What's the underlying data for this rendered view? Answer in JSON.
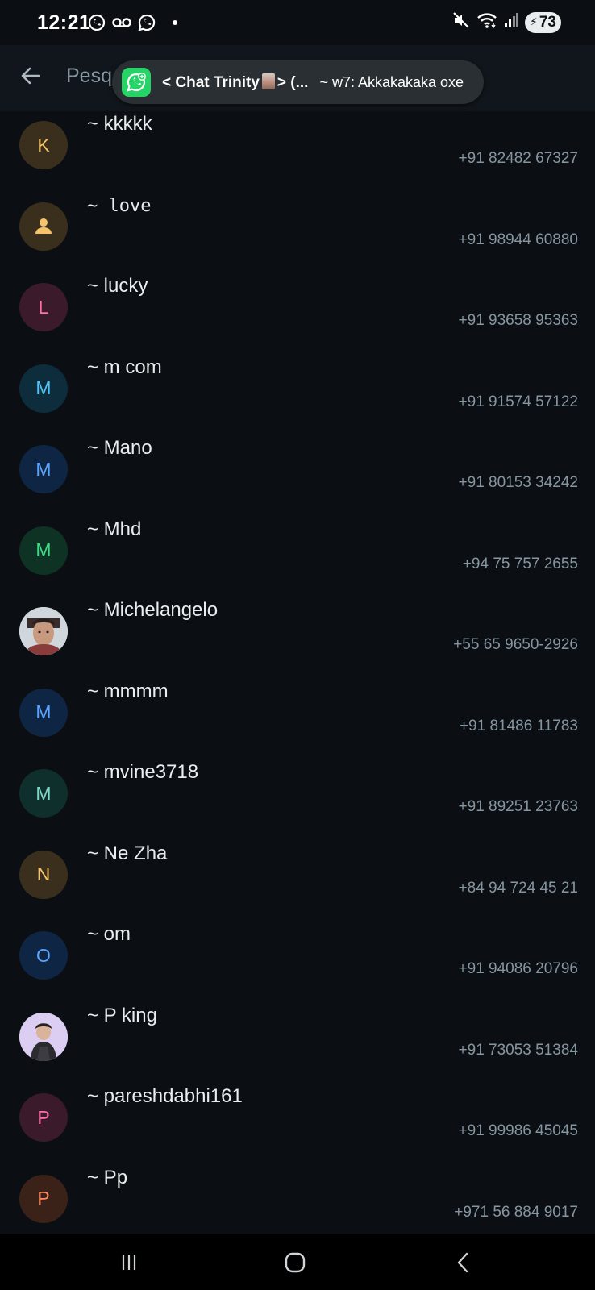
{
  "status_bar": {
    "time": "12:21",
    "left_icons": [
      "whatsapp-status-icon",
      "voicemail-icon",
      "whatsapp-icon",
      "notification-dot"
    ],
    "right_icons": [
      "mute-icon",
      "wifi-icon",
      "signal-icon"
    ],
    "battery": "73"
  },
  "header": {
    "back_icon": "arrow-left-icon",
    "search_text": "Pesq"
  },
  "notification": {
    "app_icon": "whatsapp-icon",
    "group_prefix": "< Chat Trinity",
    "group_suffix": "> (...",
    "message": "~ w7: Akkakakaka oxe"
  },
  "contacts": [
    {
      "name": "~ kkkkk",
      "phone": "+91 82482 67327",
      "initial": "K",
      "fg": "#f5c36b",
      "bg": "#3a2f1c",
      "mono": false
    },
    {
      "name": "~ love",
      "phone": "+91 98944 60880",
      "initial": "",
      "icon": "person-icon",
      "fg": "#f5c36b",
      "bg": "#3a2f1c",
      "mono": true
    },
    {
      "name": "~ lucky",
      "phone": "+91 93658 95363",
      "initial": "L",
      "fg": "#ff6fa8",
      "bg": "#3b1a2c",
      "mono": false
    },
    {
      "name": "~ m com",
      "phone": "+91 91574 57122",
      "initial": "M",
      "fg": "#4fc3f7",
      "bg": "#0d2d3c",
      "mono": false
    },
    {
      "name": "~ Mano",
      "phone": "+91 80153 34242",
      "initial": "M",
      "fg": "#5aa3ff",
      "bg": "#0f2544",
      "mono": false
    },
    {
      "name": "~ Mhd",
      "phone": "+94 75 757 2655",
      "initial": "M",
      "fg": "#3ddc84",
      "bg": "#0e3325",
      "mono": false
    },
    {
      "name": "~ Michelangelo",
      "phone": "+55 65 9650-2926",
      "initial": "",
      "photo": "photo-avatar-man",
      "fg": "#ffffff",
      "bg": "#c8d0d8",
      "mono": false
    },
    {
      "name": "~ mmmm",
      "phone": "+91 81486 11783",
      "initial": "M",
      "fg": "#5aa3ff",
      "bg": "#0f2544",
      "mono": false
    },
    {
      "name": "~ mvine3718",
      "phone": "+91 89251 23763",
      "initial": "M",
      "fg": "#7fd8c6",
      "bg": "#0f2f2c",
      "mono": false
    },
    {
      "name": "~ Ne Zha",
      "phone": "+84 94 724 45 21",
      "initial": "N",
      "fg": "#f5c36b",
      "bg": "#3a2f1c",
      "mono": false
    },
    {
      "name": "~ om",
      "phone": "+91 94086 20796",
      "initial": "O",
      "fg": "#5aa3ff",
      "bg": "#0f2544",
      "mono": false
    },
    {
      "name": "~ P king",
      "phone": "+91 73053 51384",
      "initial": "",
      "photo": "photo-avatar-cartoon",
      "fg": "#ffffff",
      "bg": "#d8c8f0",
      "mono": false
    },
    {
      "name": "~ pareshdabhi161",
      "phone": "+91 99986 45045",
      "initial": "P",
      "fg": "#ff6fa8",
      "bg": "#3b1a2c",
      "mono": false
    },
    {
      "name": "~ Pp",
      "phone": "+971 56 884 9017",
      "initial": "P",
      "fg": "#ff8a65",
      "bg": "#3a2218",
      "mono": false
    }
  ],
  "nav_bar": {
    "recents_icon": "recents-icon",
    "home_icon": "home-icon",
    "back_icon": "back-icon"
  }
}
